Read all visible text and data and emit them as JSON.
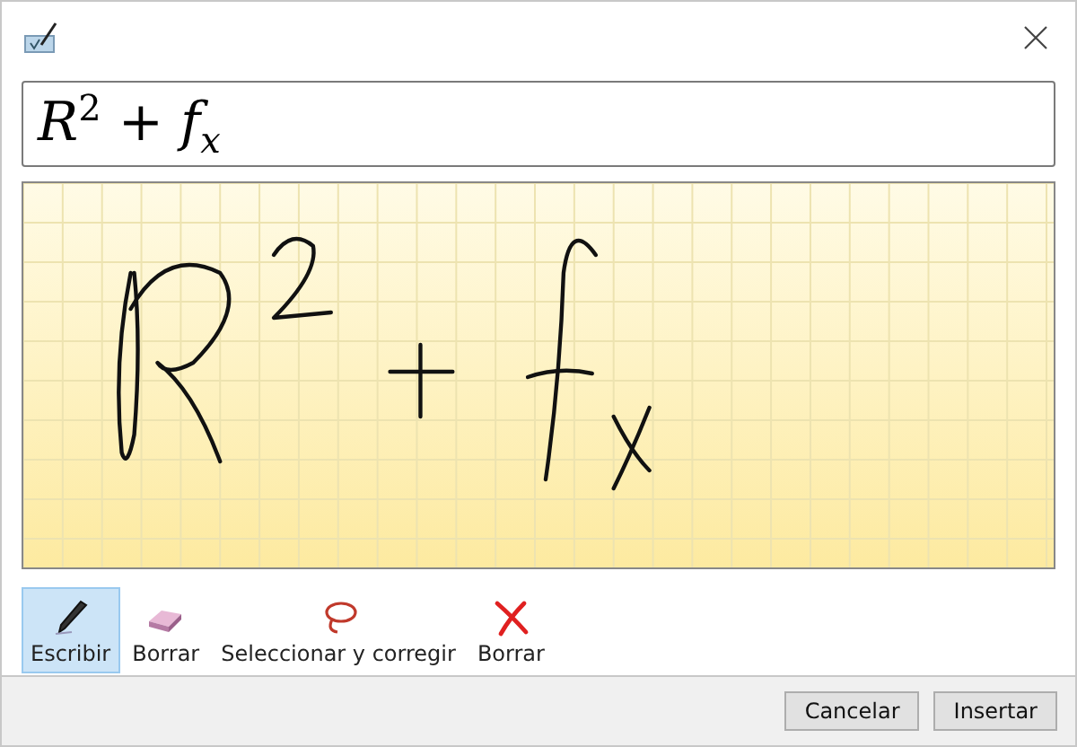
{
  "preview": {
    "formula": "*R*$^{2}$ + *f*$_{x}$"
  },
  "tools": [
    {
      "kind": "pen",
      "label": "Escribir",
      "selected": true
    },
    {
      "kind": "eraser",
      "label": "Borrar",
      "selected": false
    },
    {
      "kind": "lasso",
      "label": "Seleccionar y corregir",
      "selected": false
    },
    {
      "kind": "clear",
      "label": "Borrar",
      "selected": false
    }
  ],
  "buttons": [
    "Cancelar",
    "Insertar"
  ]
}
